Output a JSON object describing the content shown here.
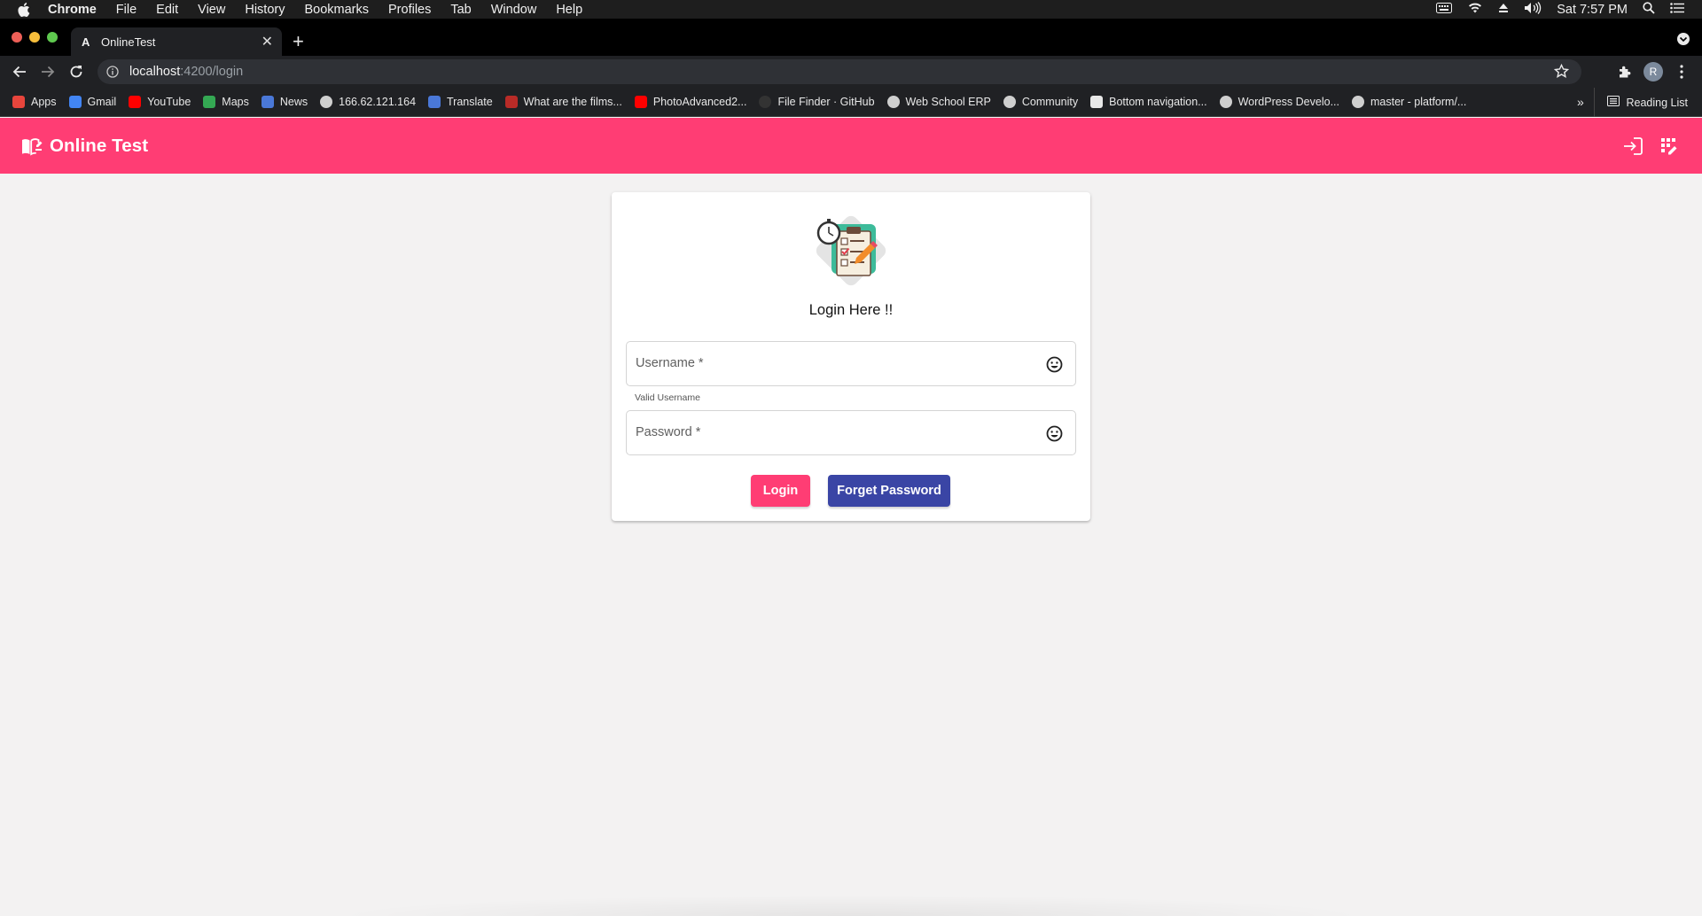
{
  "macos_menubar": {
    "app_name": "Chrome",
    "menus": [
      "File",
      "Edit",
      "View",
      "History",
      "Bookmarks",
      "Profiles",
      "Tab",
      "Window",
      "Help"
    ],
    "clock": "Sat 7:57 PM"
  },
  "browser": {
    "tab": {
      "favicon_glyph": "A",
      "title": "OnlineTest"
    },
    "url": {
      "host": "localhost",
      "path": ":4200/login"
    },
    "avatar_letter": "R",
    "bookmarks": [
      {
        "label": "Apps",
        "icon": "apps-grid-icon",
        "color": "#e8453c"
      },
      {
        "label": "Gmail",
        "icon": "google-icon",
        "color": "#4285f4"
      },
      {
        "label": "YouTube",
        "icon": "youtube-icon",
        "color": "#ff0000"
      },
      {
        "label": "Maps",
        "icon": "maps-icon",
        "color": "#34a853"
      },
      {
        "label": "News",
        "icon": "news-icon",
        "color": "#4a78d8"
      },
      {
        "label": "166.62.121.164",
        "icon": "globe-icon",
        "color": "#cfcfcf"
      },
      {
        "label": "Translate",
        "icon": "translate-icon",
        "color": "#4a78d8"
      },
      {
        "label": "What are the films...",
        "icon": "quora-icon",
        "color": "#b92b27"
      },
      {
        "label": "PhotoAdvanced2...",
        "icon": "youtube-icon",
        "color": "#ff0000"
      },
      {
        "label": "File Finder · GitHub",
        "icon": "github-icon",
        "color": "#333333"
      },
      {
        "label": "Web School ERP",
        "icon": "globe-icon",
        "color": "#cfcfcf"
      },
      {
        "label": "Community",
        "icon": "globe-icon",
        "color": "#cfcfcf"
      },
      {
        "label": "Bottom navigation...",
        "icon": "bookmark-icon",
        "color": "#e8e8e8"
      },
      {
        "label": "WordPress Develo...",
        "icon": "wordpress-icon",
        "color": "#cfcfcf"
      },
      {
        "label": "master - platform/...",
        "icon": "globe-icon",
        "color": "#cfcfcf"
      }
    ],
    "more_glyph": "»",
    "reading_list": "Reading List"
  },
  "app": {
    "title": "Online Test",
    "accent": "#ff3d74",
    "secondary": "#3a45a5"
  },
  "login": {
    "heading": "Login Here !!",
    "username_placeholder": "Username *",
    "username_hint": "Valid Username",
    "password_placeholder": "Password *",
    "login_label": "Login",
    "forget_label": "Forget Password"
  }
}
